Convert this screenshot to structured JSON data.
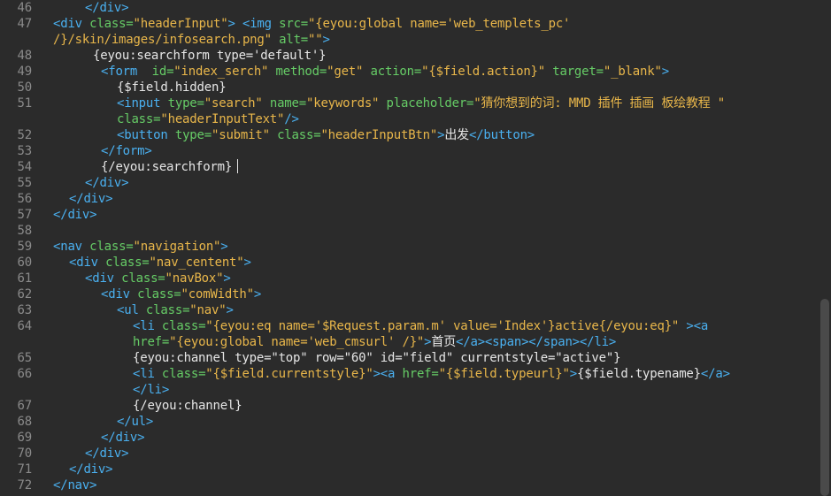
{
  "lines": [
    {
      "n": "46",
      "tokens": [
        {
          "c": "t",
          "v": "</div>"
        }
      ]
    },
    {
      "n": "47",
      "tokens": [
        {
          "c": "t",
          "v": "<div "
        },
        {
          "c": "a",
          "v": "class="
        },
        {
          "c": "s",
          "v": "\"headerInput\""
        },
        {
          "c": "t",
          "v": "> <img "
        },
        {
          "c": "a",
          "v": "src="
        },
        {
          "c": "s",
          "v": "\"{eyou:global name='web_templets_pc'"
        }
      ]
    },
    {
      "n": "",
      "tokens": [
        {
          "c": "s",
          "v": "/}/skin/images/infosearch.png\""
        },
        {
          "c": "x",
          "v": " "
        },
        {
          "c": "a",
          "v": "alt="
        },
        {
          "c": "s",
          "v": "\"\""
        },
        {
          "c": "t",
          "v": ">"
        }
      ]
    },
    {
      "n": "48",
      "tokens": [
        {
          "c": "x",
          "v": "{eyou:searchform type='default'}"
        }
      ]
    },
    {
      "n": "49",
      "tokens": [
        {
          "c": "t",
          "v": "<form  "
        },
        {
          "c": "a",
          "v": "id="
        },
        {
          "c": "s",
          "v": "\"index_serch\""
        },
        {
          "c": "x",
          "v": " "
        },
        {
          "c": "a",
          "v": "method="
        },
        {
          "c": "s",
          "v": "\"get\""
        },
        {
          "c": "x",
          "v": " "
        },
        {
          "c": "a",
          "v": "action="
        },
        {
          "c": "s",
          "v": "\"{$field.action}\""
        },
        {
          "c": "x",
          "v": " "
        },
        {
          "c": "a",
          "v": "target="
        },
        {
          "c": "s",
          "v": "\"_blank\""
        },
        {
          "c": "t",
          "v": ">"
        }
      ]
    },
    {
      "n": "50",
      "tokens": [
        {
          "c": "x",
          "v": "{$field.hidden}"
        }
      ]
    },
    {
      "n": "51",
      "tokens": [
        {
          "c": "t",
          "v": "<input "
        },
        {
          "c": "a",
          "v": "type="
        },
        {
          "c": "s",
          "v": "\"search\""
        },
        {
          "c": "x",
          "v": " "
        },
        {
          "c": "a",
          "v": "name="
        },
        {
          "c": "s",
          "v": "\"keywords\""
        },
        {
          "c": "x",
          "v": " "
        },
        {
          "c": "a",
          "v": "placeholder="
        },
        {
          "c": "s",
          "v": "\"猜你想到的词: MMD 插件 插画 板绘教程 \""
        }
      ]
    },
    {
      "n": "",
      "tokens": [
        {
          "c": "a",
          "v": "class="
        },
        {
          "c": "s",
          "v": "\"headerInputText\""
        },
        {
          "c": "t",
          "v": "/>"
        }
      ]
    },
    {
      "n": "52",
      "tokens": [
        {
          "c": "t",
          "v": "<button "
        },
        {
          "c": "a",
          "v": "type="
        },
        {
          "c": "s",
          "v": "\"submit\""
        },
        {
          "c": "x",
          "v": " "
        },
        {
          "c": "a",
          "v": "class="
        },
        {
          "c": "s",
          "v": "\"headerInputBtn\""
        },
        {
          "c": "t",
          "v": ">"
        },
        {
          "c": "x",
          "v": "出发"
        },
        {
          "c": "t",
          "v": "</button>"
        }
      ]
    },
    {
      "n": "53",
      "tokens": [
        {
          "c": "t",
          "v": "</form>"
        }
      ]
    },
    {
      "n": "54",
      "tokens": [
        {
          "c": "x",
          "v": "{/eyou:searchform}"
        }
      ]
    },
    {
      "n": "55",
      "tokens": [
        {
          "c": "t",
          "v": "</div>"
        }
      ]
    },
    {
      "n": "56",
      "tokens": [
        {
          "c": "t",
          "v": "</div>"
        }
      ]
    },
    {
      "n": "57",
      "tokens": [
        {
          "c": "t",
          "v": "</div>"
        }
      ]
    },
    {
      "n": "58",
      "tokens": []
    },
    {
      "n": "59",
      "tokens": [
        {
          "c": "t",
          "v": "<nav "
        },
        {
          "c": "a",
          "v": "class="
        },
        {
          "c": "s",
          "v": "\"navigation\""
        },
        {
          "c": "t",
          "v": ">"
        }
      ]
    },
    {
      "n": "60",
      "tokens": [
        {
          "c": "t",
          "v": "<div "
        },
        {
          "c": "a",
          "v": "class="
        },
        {
          "c": "s",
          "v": "\"nav_centent\""
        },
        {
          "c": "t",
          "v": ">"
        }
      ]
    },
    {
      "n": "61",
      "tokens": [
        {
          "c": "t",
          "v": "<div "
        },
        {
          "c": "a",
          "v": "class="
        },
        {
          "c": "s",
          "v": "\"navBox\""
        },
        {
          "c": "t",
          "v": ">"
        }
      ]
    },
    {
      "n": "62",
      "tokens": [
        {
          "c": "t",
          "v": "<div "
        },
        {
          "c": "a",
          "v": "class="
        },
        {
          "c": "s",
          "v": "\"comWidth\""
        },
        {
          "c": "t",
          "v": ">"
        }
      ]
    },
    {
      "n": "63",
      "tokens": [
        {
          "c": "t",
          "v": "<ul "
        },
        {
          "c": "a",
          "v": "class="
        },
        {
          "c": "s",
          "v": "\"nav\""
        },
        {
          "c": "t",
          "v": ">"
        }
      ]
    },
    {
      "n": "64",
      "tokens": [
        {
          "c": "t",
          "v": "<li "
        },
        {
          "c": "a",
          "v": "class="
        },
        {
          "c": "s",
          "v": "\"{eyou:eq name='$Request.param.m' value='Index'}active{/eyou:eq}\""
        },
        {
          "c": "x",
          "v": " "
        },
        {
          "c": "t",
          "v": "><a"
        }
      ]
    },
    {
      "n": "",
      "tokens": [
        {
          "c": "a",
          "v": "href="
        },
        {
          "c": "s",
          "v": "\"{eyou:global name='web_cmsurl' /}\""
        },
        {
          "c": "t",
          "v": ">"
        },
        {
          "c": "x",
          "v": "首页"
        },
        {
          "c": "t",
          "v": "</a><span></span></li>"
        }
      ]
    },
    {
      "n": "65",
      "tokens": [
        {
          "c": "x",
          "v": "{eyou:channel type=\"top\" row=\"60\" id=\"field\" currentstyle=\"active\"}"
        }
      ]
    },
    {
      "n": "66",
      "tokens": [
        {
          "c": "t",
          "v": "<li "
        },
        {
          "c": "a",
          "v": "class="
        },
        {
          "c": "s",
          "v": "\"{$field.currentstyle}\""
        },
        {
          "c": "t",
          "v": "><a "
        },
        {
          "c": "a",
          "v": "href="
        },
        {
          "c": "s",
          "v": "\"{$field.typeurl}\""
        },
        {
          "c": "t",
          "v": ">"
        },
        {
          "c": "x",
          "v": "{$field.typename}"
        },
        {
          "c": "t",
          "v": "</a>"
        }
      ]
    },
    {
      "n": "",
      "tokens": [
        {
          "c": "t",
          "v": "</li>"
        }
      ]
    },
    {
      "n": "67",
      "tokens": [
        {
          "c": "x",
          "v": "{/eyou:channel}"
        }
      ]
    },
    {
      "n": "68",
      "tokens": [
        {
          "c": "t",
          "v": "</ul>"
        }
      ]
    },
    {
      "n": "69",
      "tokens": [
        {
          "c": "t",
          "v": "</div>"
        }
      ]
    },
    {
      "n": "70",
      "tokens": [
        {
          "c": "t",
          "v": "</div>"
        }
      ]
    },
    {
      "n": "71",
      "tokens": [
        {
          "c": "t",
          "v": "</div>"
        }
      ]
    },
    {
      "n": "72",
      "tokens": [
        {
          "c": "t",
          "v": "</nav>"
        }
      ]
    }
  ]
}
